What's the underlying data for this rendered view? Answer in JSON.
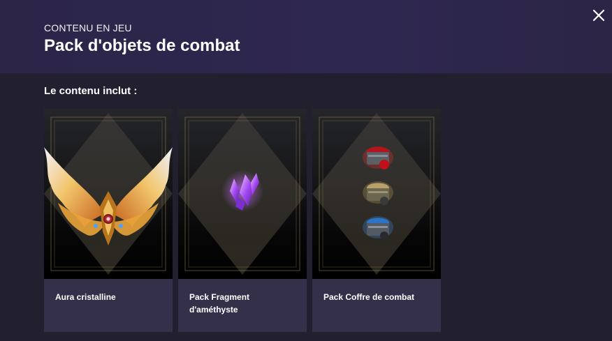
{
  "header": {
    "eyebrow": "CONTENU EN JEU",
    "title": "Pack d'objets de combat"
  },
  "content": {
    "section_label": "Le contenu inclut :",
    "items": [
      {
        "name": "Aura cristalline",
        "icon": "crystal-wings-aura-icon"
      },
      {
        "name": "Pack Fragment d'améthyste",
        "icon": "amethyst-fragment-icon"
      },
      {
        "name": "Pack Coffre de combat",
        "icon": "combat-chest-icon"
      }
    ]
  },
  "colors": {
    "header_bg": "#2e2750",
    "page_bg": "#221f2e",
    "card_label_bg": "#35304a",
    "frame_gold": "#9c8450"
  }
}
